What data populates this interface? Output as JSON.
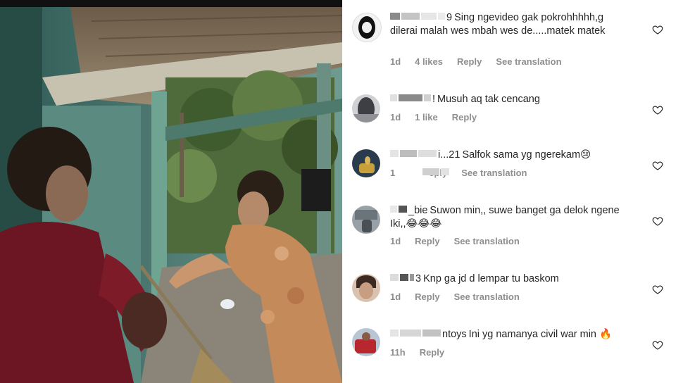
{
  "comments": [
    {
      "username_visible": "9",
      "text": "Sing ngevideo gak pokrohhhhh,g dilerai malah wes mbah wes de.....matek matek",
      "time": "1d",
      "likes": "4 likes",
      "reply": "Reply",
      "translation": "See translation"
    },
    {
      "username_visible": "!",
      "text": "Musuh aq tak cencang",
      "time": "1d",
      "likes": "1 like",
      "reply": "Reply",
      "translation": ""
    },
    {
      "username_visible": "i...21",
      "text": "Salfok sama yg ngerekam😢",
      "time": "1",
      "likes": "",
      "reply": "eply",
      "translation": "See translation"
    },
    {
      "username_visible": "_bie",
      "text": "Suwon min,, suwe banget ga delok ngene Iki,,😂😂😂",
      "time": "1d",
      "likes": "",
      "reply": "Reply",
      "translation": "See translation"
    },
    {
      "username_visible": "3",
      "text": "Knp ga jd d lempar tu baskom",
      "time": "1d",
      "likes": "",
      "reply": "Reply",
      "translation": "See translation"
    },
    {
      "username_visible": "ntoys",
      "text": "Ini yg namanya civil war min 🔥",
      "time": "11h",
      "likes": "",
      "reply": "Reply",
      "translation": ""
    }
  ],
  "icons": {
    "like": "heart-outline-icon"
  },
  "colors": {
    "text": "#262626",
    "meta": "#8e8e8e",
    "background": "#ffffff"
  }
}
